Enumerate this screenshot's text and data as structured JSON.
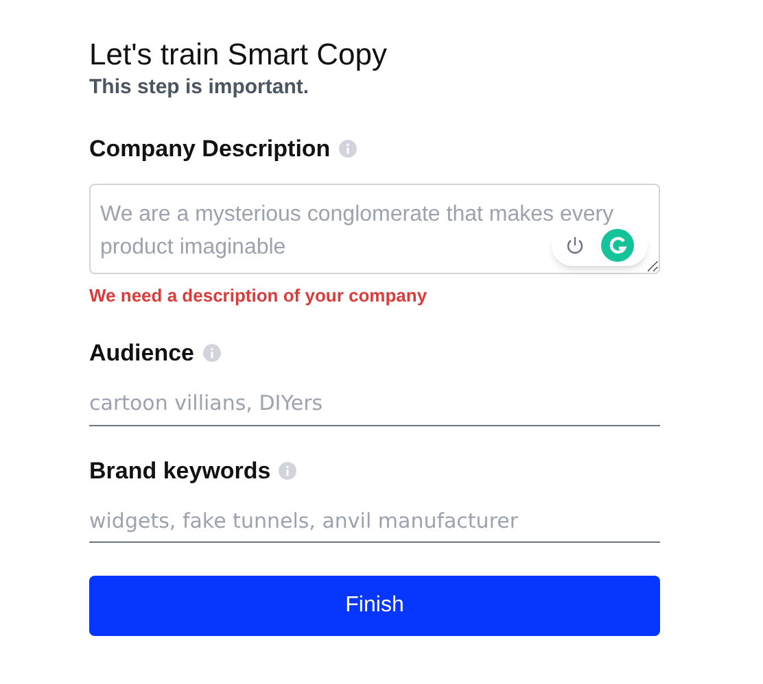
{
  "title": "Let's train Smart Copy",
  "subtitle": "This step is important.",
  "fields": [
    {
      "kind": "textarea",
      "label": "Company Description",
      "placeholder": "We are a mysterious conglomerate that makes every product imaginable",
      "error": "We need a description of your company",
      "assistant_widget": true
    },
    {
      "kind": "line",
      "label": "Audience",
      "placeholder": "cartoon villians, DIYers"
    },
    {
      "kind": "line",
      "label": "Brand keywords",
      "placeholder": "widgets, fake tunnels, anvil manufacturer"
    }
  ],
  "submit": "Finish"
}
